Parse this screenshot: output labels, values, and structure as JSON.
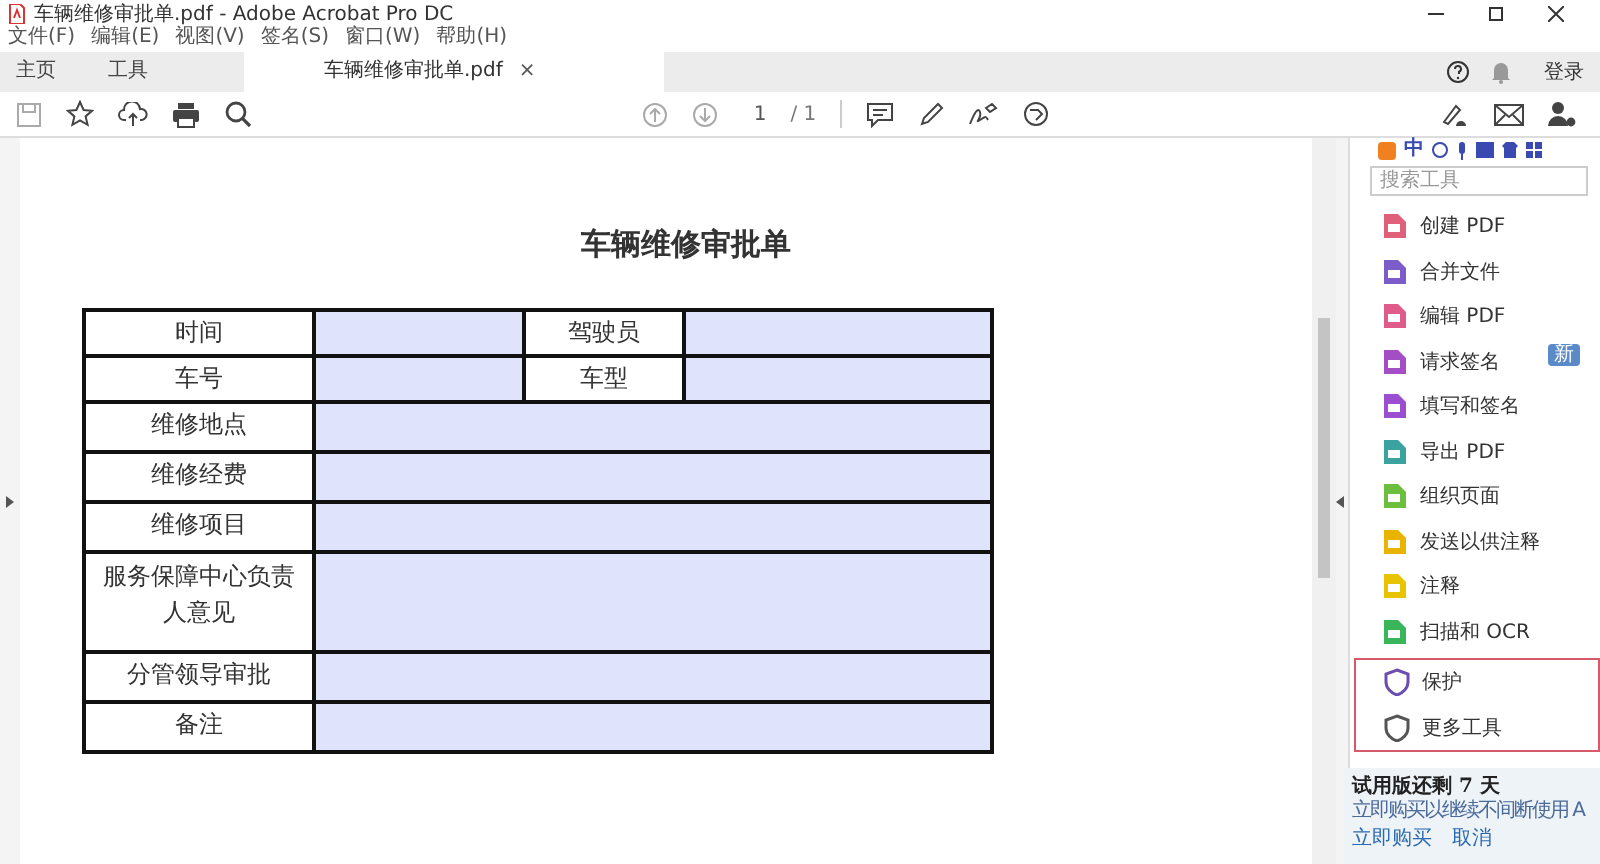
{
  "window": {
    "title": "车辆维修审批单.pdf - Adobe Acrobat Pro DC"
  },
  "menu": [
    "文件(F)",
    "编辑(E)",
    "视图(V)",
    "签名(S)",
    "窗口(W)",
    "帮助(H)"
  ],
  "tabs": [
    {
      "label": "主页",
      "selected": false
    },
    {
      "label": "工具",
      "selected": false
    },
    {
      "label": "车辆维修审批单.pdf",
      "selected": true,
      "closable": true
    }
  ],
  "close_glyph": "×",
  "sign_in": "登录",
  "page_nav": {
    "current": "1",
    "total": "/ 1"
  },
  "ime": {
    "mode": "中"
  },
  "document": {
    "title": "车辆维修审批单",
    "rows": [
      {
        "kind": "pair",
        "labels": [
          "时间",
          "驾驶员"
        ]
      },
      {
        "kind": "pair",
        "labels": [
          "车号",
          "车型"
        ]
      },
      {
        "kind": "wide",
        "labels": [
          "维修地点"
        ]
      },
      {
        "kind": "wide",
        "labels": [
          "维修经费"
        ]
      },
      {
        "kind": "wide",
        "labels": [
          "维修项目"
        ]
      },
      {
        "kind": "tall",
        "labels": [
          "服务保障中心负责人意见"
        ]
      },
      {
        "kind": "wide",
        "labels": [
          "分管领导审批"
        ]
      },
      {
        "kind": "wide",
        "labels": [
          "备注"
        ]
      }
    ]
  },
  "tools_panel": {
    "search": {
      "placeholder": "搜索工具"
    },
    "tools": [
      {
        "label": "创建 PDF",
        "color": "#e0607a"
      },
      {
        "label": "合并文件",
        "color": "#7b5cc9"
      },
      {
        "label": "编辑 PDF",
        "color": "#e05a8a"
      },
      {
        "label": "请求签名",
        "color": "#a34ec4",
        "badge": "新"
      },
      {
        "label": "填写和签名",
        "color": "#9b4fd0"
      },
      {
        "label": "导出 PDF",
        "color": "#3aa3a0"
      },
      {
        "label": "组织页面",
        "color": "#6cbf3c"
      },
      {
        "label": "发送以供注释",
        "color": "#e8b400"
      },
      {
        "label": "注释",
        "color": "#e8c400"
      },
      {
        "label": "扫描和 OCR",
        "color": "#3ab55a"
      }
    ],
    "highlighted_tools": [
      {
        "label": "保护",
        "color": "#6a4fb0"
      },
      {
        "label": "更多工具",
        "color": "#555555"
      }
    ]
  },
  "trial": {
    "title": "试用版还剩 7 天",
    "message": "立即购买以继续不间断使用 A",
    "buy": "立即购买",
    "cancel": "取消"
  }
}
